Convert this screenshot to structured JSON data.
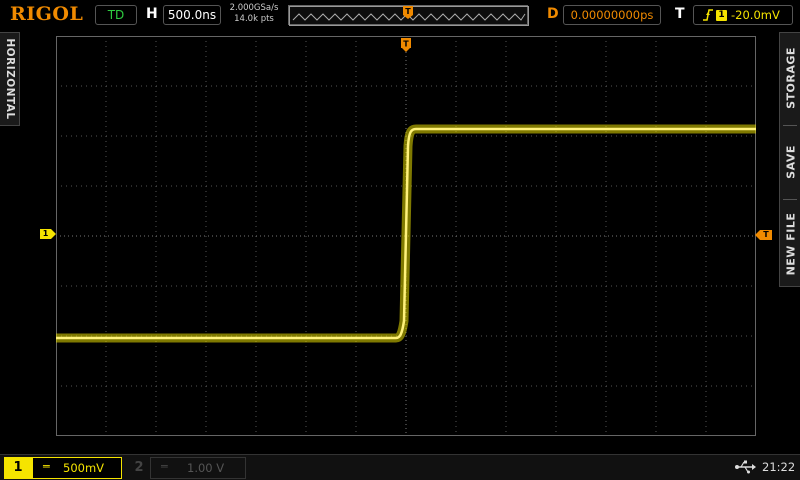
{
  "brand": "RIGOL",
  "timebase": {
    "mode": "TD",
    "h_label": "H",
    "h_scale": "500.0ns",
    "sample_rate": "2.000GSa/s",
    "points": "14.0k pts",
    "delay_label": "D",
    "delay": "0.00000000ps"
  },
  "trigger": {
    "t_label": "T",
    "source": "1",
    "level": "-20.0mV",
    "edge_icon": "rising-edge-icon",
    "pos_marker": "T",
    "level_marker": "T"
  },
  "side_tabs": {
    "left": "HORIZONTAL",
    "right": [
      "STORAGE",
      "SAVE",
      "NEW FILE"
    ]
  },
  "channels": [
    {
      "num": "1",
      "coupling_icon": "dc-coupling-icon",
      "coupling": "═",
      "scale": "500mV",
      "active": true,
      "color": "#f5e400"
    },
    {
      "num": "2",
      "coupling_icon": "dc-coupling-icon",
      "coupling": "═",
      "scale": "1.00 V",
      "active": false,
      "color": "#444444"
    }
  ],
  "ch1_marker": "1",
  "status": {
    "usb_icon": "usb-icon",
    "time": "21:22"
  },
  "colors": {
    "accent": "#f08a00",
    "channel1": "#f5e400",
    "timebase_mode": "#2ecc40"
  }
}
